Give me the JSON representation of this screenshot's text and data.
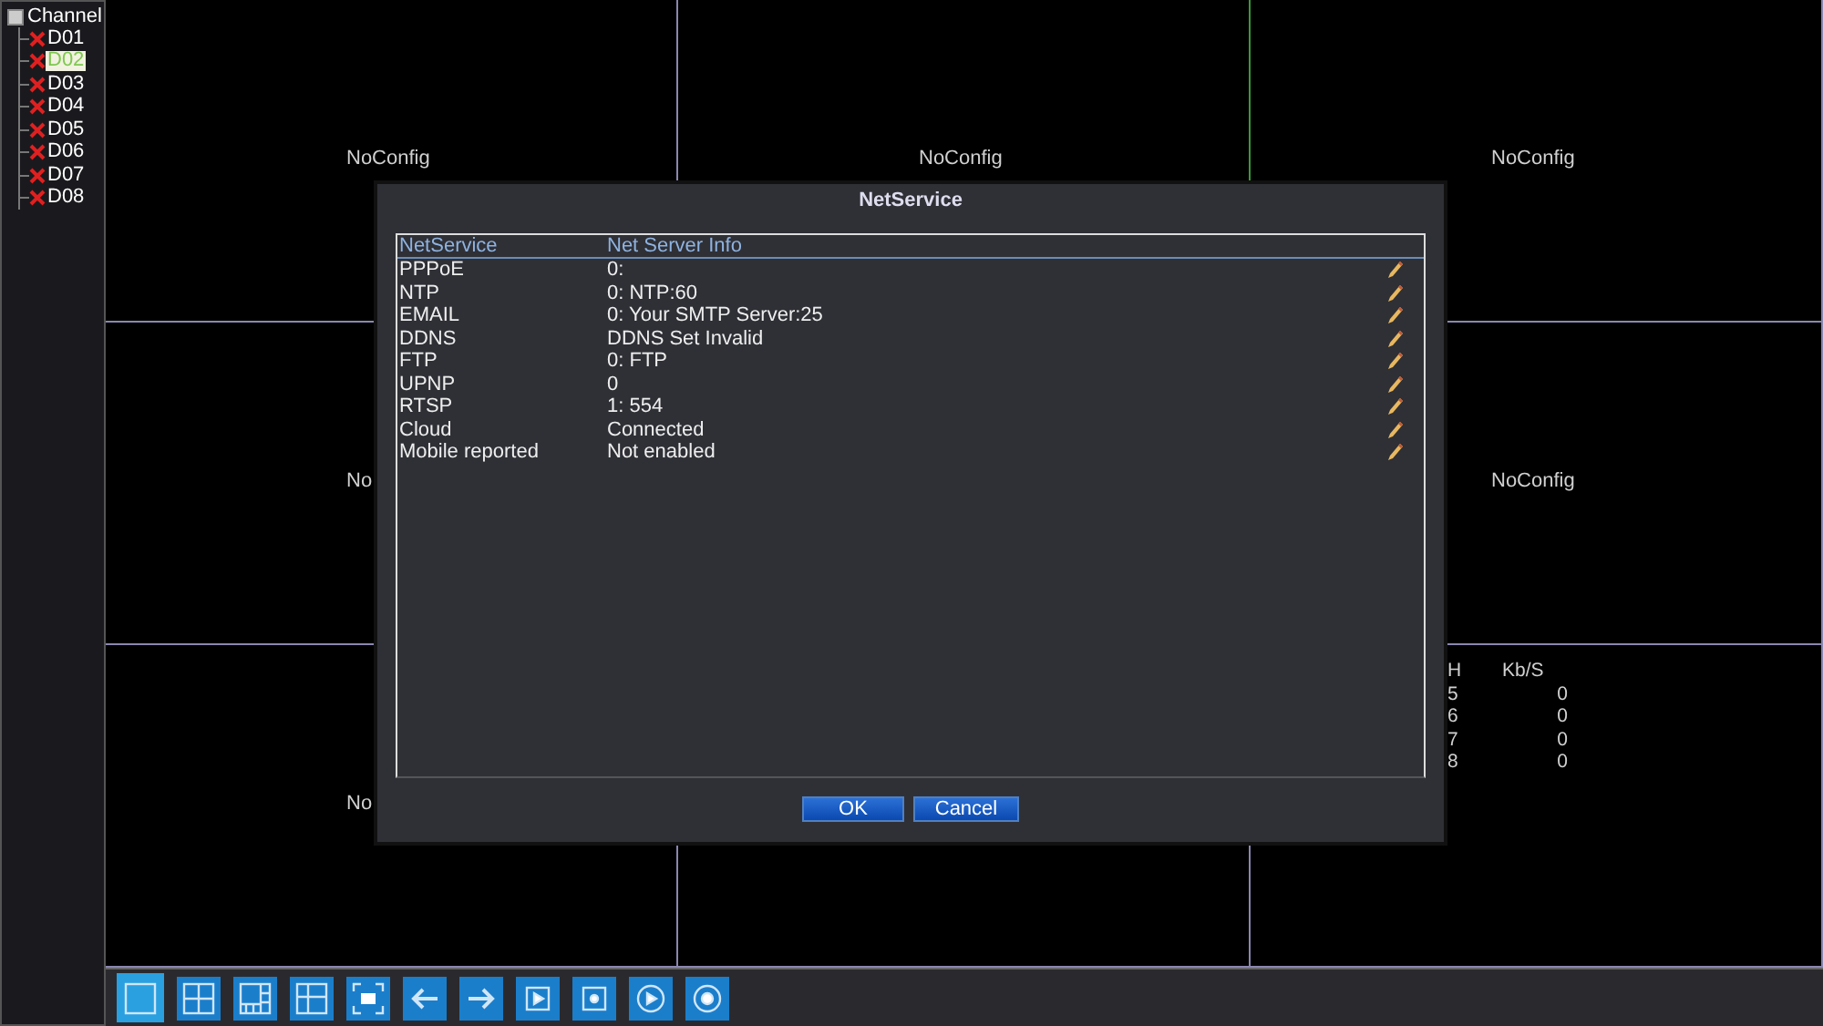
{
  "sidebar": {
    "root": {
      "label": "Channel",
      "expanded": true,
      "children": [
        {
          "label": "D01",
          "selected": false
        },
        {
          "label": "D02",
          "selected": true
        },
        {
          "label": "D03",
          "selected": false
        },
        {
          "label": "D04",
          "selected": false
        },
        {
          "label": "D05",
          "selected": false
        },
        {
          "label": "D06",
          "selected": false
        },
        {
          "label": "D07",
          "selected": false
        },
        {
          "label": "D08",
          "selected": false
        }
      ]
    }
  },
  "grid": {
    "cells": [
      {
        "label": "NoConfig",
        "selected": false
      },
      {
        "label": "NoConfig",
        "selected": true
      },
      {
        "label": "NoConfig",
        "selected": false
      },
      {
        "label": "No",
        "selected": false
      },
      {},
      {
        "label": "NoConfig",
        "selected": false
      },
      {
        "label": "No",
        "selected": false
      },
      {
        "selected": false
      },
      {
        "selected": false,
        "stats": {
          "columns": [
            "H",
            "Kb/S"
          ],
          "rows": [
            [
              "5",
              "0"
            ],
            [
              "6",
              "0"
            ],
            [
              "7",
              "0"
            ],
            [
              "8",
              "0"
            ]
          ]
        }
      }
    ]
  },
  "dialog": {
    "title": "NetService",
    "columns": [
      "NetService",
      "Net Server Info"
    ],
    "rows": [
      {
        "service": "PPPoE",
        "info": "0:"
      },
      {
        "service": "NTP",
        "info": "0: NTP:60"
      },
      {
        "service": "EMAIL",
        "info": "0: Your SMTP Server:25"
      },
      {
        "service": "DDNS",
        "info": "DDNS Set Invalid"
      },
      {
        "service": "FTP",
        "info": "0: FTP"
      },
      {
        "service": "UPNP",
        "info": "0"
      },
      {
        "service": "RTSP",
        "info": "1: 554"
      },
      {
        "service": "Cloud",
        "info": "Connected"
      },
      {
        "service": "Mobile reported",
        "info": "Not enabled"
      }
    ],
    "buttons": [
      "OK",
      "Cancel"
    ]
  },
  "toolbar": {
    "buttons": [
      {
        "kind": "single",
        "selected": true
      },
      {
        "kind": "quad",
        "selected": false
      },
      {
        "kind": "multi",
        "selected": false
      },
      {
        "kind": "split",
        "selected": false
      },
      {
        "kind": "fullscreen",
        "selected": false
      },
      {
        "kind": "prev",
        "selected": false
      },
      {
        "kind": "next",
        "selected": false
      },
      {
        "kind": "play-square",
        "selected": false
      },
      {
        "kind": "record-square",
        "selected": false
      },
      {
        "kind": "play-circle",
        "selected": false
      },
      {
        "kind": "record-circle",
        "selected": false
      }
    ]
  }
}
